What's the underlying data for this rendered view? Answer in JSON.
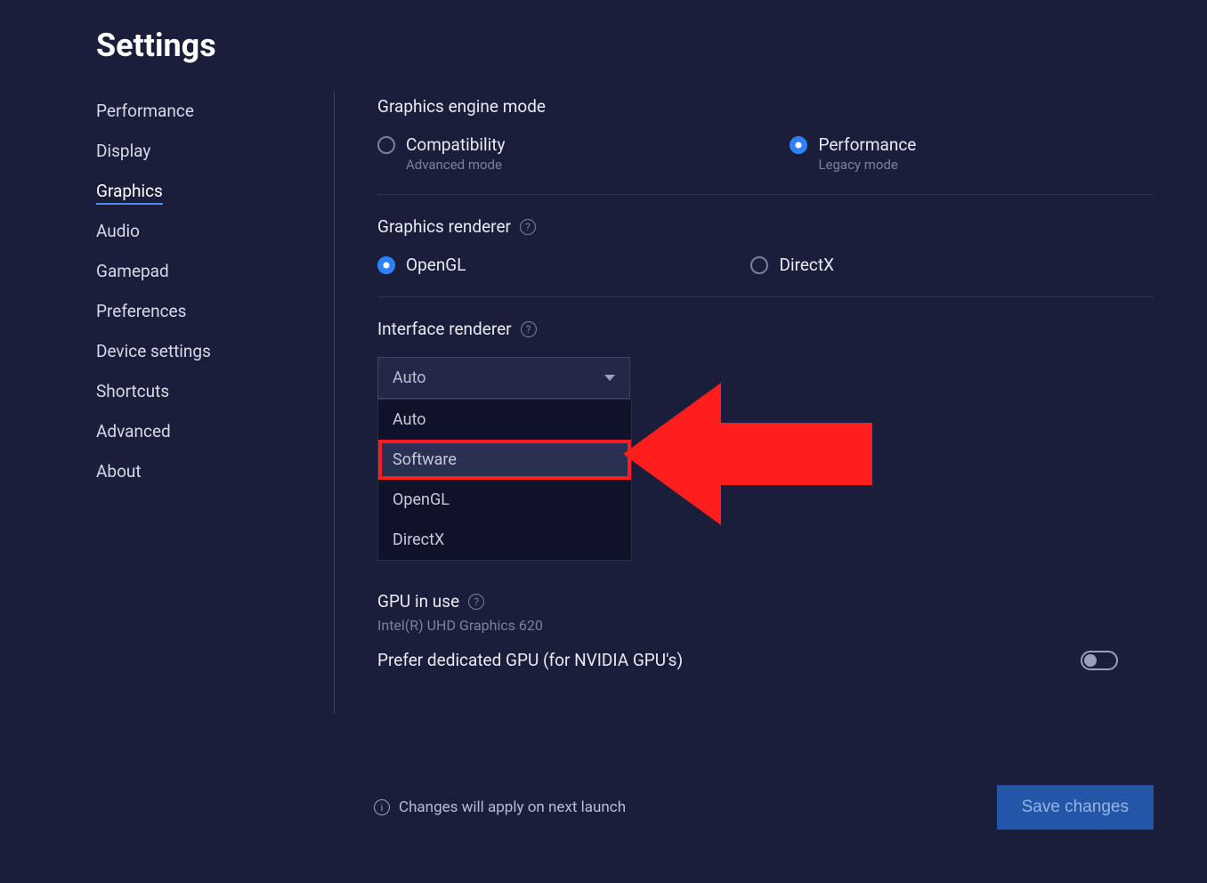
{
  "page": {
    "title": "Settings"
  },
  "sidebar": {
    "items": [
      {
        "label": "Performance"
      },
      {
        "label": "Display"
      },
      {
        "label": "Graphics",
        "active": true
      },
      {
        "label": "Audio"
      },
      {
        "label": "Gamepad"
      },
      {
        "label": "Preferences"
      },
      {
        "label": "Device settings"
      },
      {
        "label": "Shortcuts"
      },
      {
        "label": "Advanced"
      },
      {
        "label": "About"
      }
    ]
  },
  "graphics_engine": {
    "title": "Graphics engine mode",
    "options": [
      {
        "label": "Compatibility",
        "sub": "Advanced mode",
        "selected": false
      },
      {
        "label": "Performance",
        "sub": "Legacy mode",
        "selected": true
      }
    ]
  },
  "graphics_renderer": {
    "title": "Graphics renderer",
    "options": [
      {
        "label": "OpenGL",
        "selected": true
      },
      {
        "label": "DirectX",
        "selected": false
      }
    ]
  },
  "interface_renderer": {
    "title": "Interface renderer",
    "selected": "Auto",
    "options": [
      "Auto",
      "Software",
      "OpenGL",
      "DirectX"
    ],
    "highlighted_index": 1
  },
  "gpu": {
    "title": "GPU in use",
    "name": "Intel(R) UHD Graphics 620",
    "prefer_label": "Prefer dedicated GPU (for NVIDIA GPU's)",
    "prefer_enabled": false
  },
  "footer": {
    "note": "Changes will apply on next launch",
    "save": "Save changes"
  },
  "annotation": {
    "color": "#ff1e1e"
  }
}
